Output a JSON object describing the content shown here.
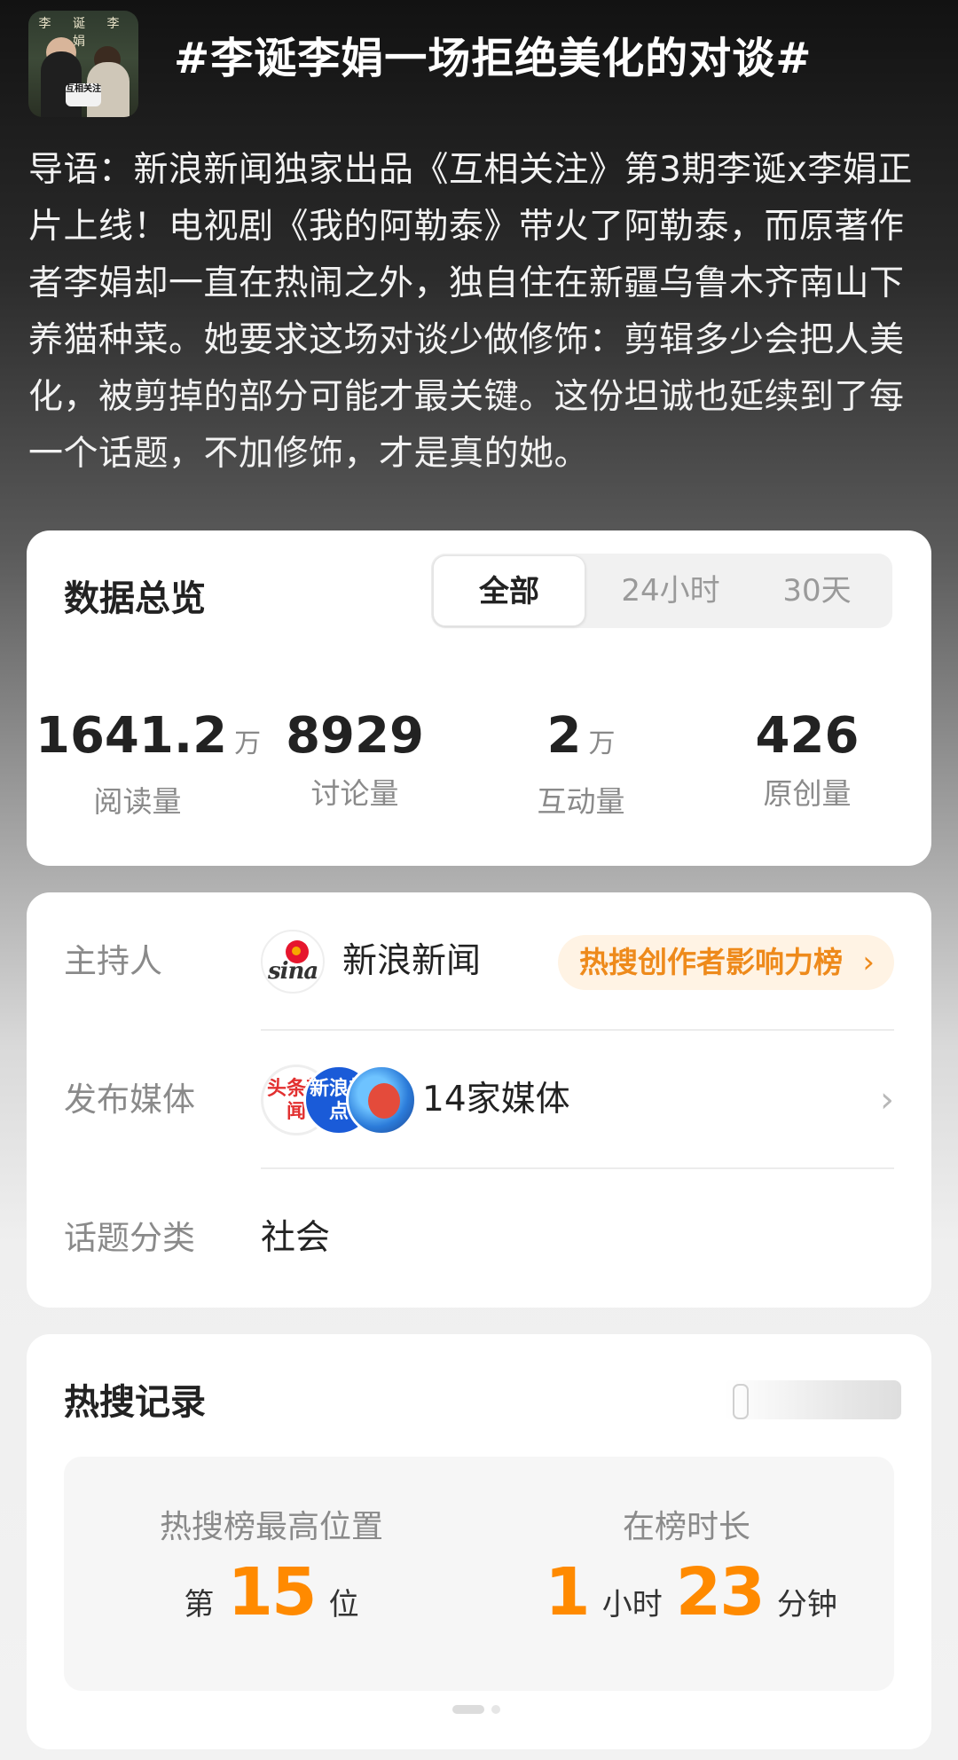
{
  "header": {
    "title": "#李诞李娟一场拒绝美化的对谈#",
    "cover_text": "李 诞 李 娟",
    "cover_badge": "互相关注"
  },
  "intro": "导语：新浪新闻独家出品《互相关注》第3期李诞x李娟正片上线！电视剧《我的阿勒泰》带火了阿勒泰，而原著作者李娟却一直在热闹之外，独自住在新疆乌鲁木齐南山下养猫种菜。她要求这场对谈少做修饰：剪辑多少会把人美化，被剪掉的部分可能才最关键。这份坦诚也延续到了每一个话题，不加修饰，才是真的她。",
  "stats": {
    "heading": "数据总览",
    "tabs": [
      "全部",
      "24小时",
      "30天"
    ],
    "active_tab": "全部",
    "items": [
      {
        "value": "1641.2",
        "unit": "万",
        "label": "阅读量"
      },
      {
        "value": "8929",
        "unit": "",
        "label": "讨论量"
      },
      {
        "value": "2",
        "unit": "万",
        "label": "互动量"
      },
      {
        "value": "426",
        "unit": "",
        "label": "原创量"
      }
    ]
  },
  "info": {
    "host_label": "主持人",
    "host_name": "新浪新闻",
    "host_logo_text": "sina",
    "host_tag": "热搜创作者影响力榜",
    "media_label": "发布媒体",
    "media_avatars": [
      "头条新闻",
      "新浪热点",
      ""
    ],
    "media_count": "14家媒体",
    "category_label": "话题分类",
    "category_value": "社会"
  },
  "hot": {
    "heading": "热搜记录",
    "peak_label": "热搜榜最高位置",
    "peak_prefix": "第",
    "peak_value": "15",
    "peak_suffix": "位",
    "duration_label": "在榜时长",
    "hours": "1",
    "hours_unit": "小时",
    "minutes": "23",
    "minutes_unit": "分钟"
  },
  "colors": {
    "accent_orange": "#ff8a00",
    "tag_text": "#ee8a1b",
    "tag_bg": "#fff3e4"
  },
  "icons": {
    "pill_chevron": "chevron-right-icon",
    "media_chevron": "chevron-right-icon"
  }
}
